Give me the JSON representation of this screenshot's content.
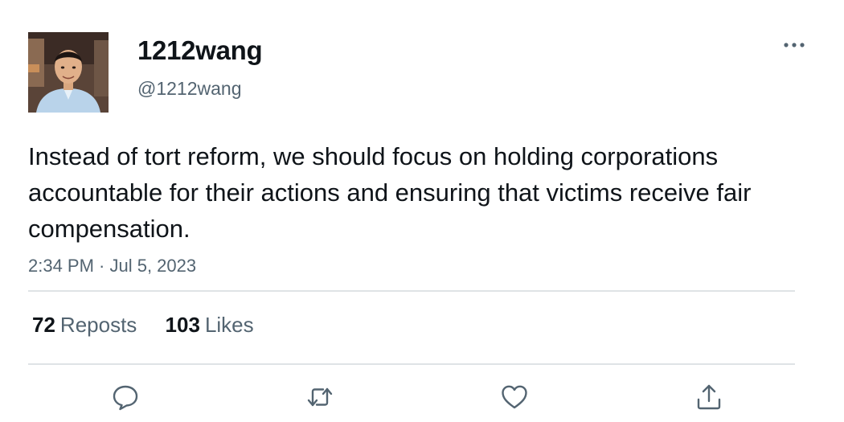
{
  "user": {
    "display_name": "1212wang",
    "handle": "@1212wang",
    "avatar_icon": "profile-photo"
  },
  "tweet": {
    "text": "Instead of tort reform, we should focus on holding corporations accountable for their actions and ensuring that victims receive fair compensation.",
    "timestamp": "2:34 PM · Jul 5, 2023"
  },
  "stats": {
    "reposts_count": "72",
    "reposts_label": "Reposts",
    "likes_count": "103",
    "likes_label": "Likes"
  },
  "actions": {
    "reply_icon": "speech-bubble-icon",
    "repost_icon": "repost-arrows-icon",
    "like_icon": "heart-icon",
    "share_icon": "upload-icon"
  },
  "menu": {
    "more_icon": "ellipsis-icon"
  },
  "colors": {
    "primary_text": "#0f1419",
    "secondary_text": "#536471",
    "divider": "#dfe3e6",
    "icon": "#536471"
  }
}
